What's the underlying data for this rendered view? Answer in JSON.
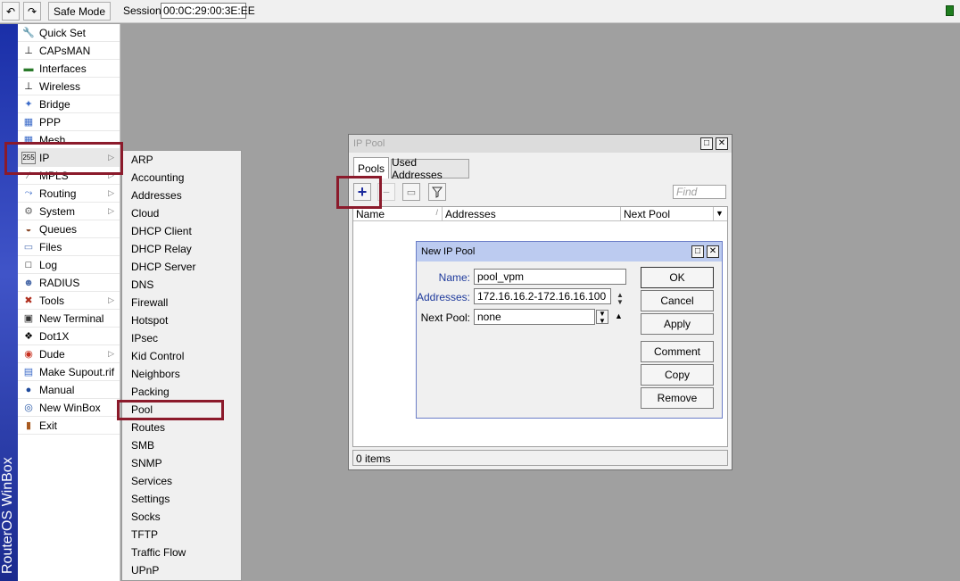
{
  "toolbar": {
    "undo_icon": "undo-icon",
    "redo_icon": "redo-icon",
    "safe_mode": "Safe Mode",
    "session_label": "Session:",
    "session_value": "00:0C:29:00:3E:EE"
  },
  "side_strip": {
    "brand": "RouterOS WinBox"
  },
  "main_menu": {
    "items": [
      {
        "label": "Quick Set",
        "icon": "quick-set-icon"
      },
      {
        "label": "CAPsMAN",
        "icon": "antenna-icon"
      },
      {
        "label": "Interfaces",
        "icon": "interfaces-icon"
      },
      {
        "label": "Wireless",
        "icon": "antenna-icon"
      },
      {
        "label": "Bridge",
        "icon": "bridge-icon"
      },
      {
        "label": "PPP",
        "icon": "ppp-icon"
      },
      {
        "label": "Mesh",
        "icon": "mesh-icon"
      },
      {
        "label": "IP",
        "icon": "ip-icon"
      },
      {
        "label": "MPLS",
        "icon": "mpls-icon"
      },
      {
        "label": "Routing",
        "icon": "routing-icon"
      },
      {
        "label": "System",
        "icon": "gear-icon"
      },
      {
        "label": "Queues",
        "icon": "queues-icon"
      },
      {
        "label": "Files",
        "icon": "folder-icon"
      },
      {
        "label": "Log",
        "icon": "log-icon"
      },
      {
        "label": "RADIUS",
        "icon": "radius-icon"
      },
      {
        "label": "Tools",
        "icon": "tools-icon"
      },
      {
        "label": "New Terminal",
        "icon": "terminal-icon"
      },
      {
        "label": "Dot1X",
        "icon": "dot1x-icon"
      },
      {
        "label": "Dude",
        "icon": "dude-icon"
      },
      {
        "label": "Make Supout.rif",
        "icon": "document-icon"
      },
      {
        "label": "Manual",
        "icon": "help-icon"
      },
      {
        "label": "New WinBox",
        "icon": "winbox-icon"
      },
      {
        "label": "Exit",
        "icon": "exit-icon"
      }
    ]
  },
  "ip_submenu": {
    "items": [
      "ARP",
      "Accounting",
      "Addresses",
      "Cloud",
      "DHCP Client",
      "DHCP Relay",
      "DHCP Server",
      "DNS",
      "Firewall",
      "Hotspot",
      "IPsec",
      "Kid Control",
      "Neighbors",
      "Packing",
      "Pool",
      "Routes",
      "SMB",
      "SNMP",
      "Services",
      "Settings",
      "Socks",
      "TFTP",
      "Traffic Flow",
      "UPnP"
    ]
  },
  "ip_pool_window": {
    "title": "IP Pool",
    "tabs": [
      "Pools",
      "Used Addresses"
    ],
    "find_placeholder": "Find",
    "columns": [
      "Name",
      "Addresses",
      "Next Pool"
    ],
    "status": "0 items"
  },
  "new_pool_dialog": {
    "title": "New IP Pool",
    "name_label": "Name:",
    "name_value": "pool_vpm",
    "addresses_label": "Addresses:",
    "addresses_value": "172.16.16.2-172.16.16.100",
    "next_pool_label": "Next Pool:",
    "next_pool_value": "none",
    "buttons": [
      "OK",
      "Cancel",
      "Apply",
      "Comment",
      "Copy",
      "Remove"
    ]
  },
  "colors": {
    "highlight": "#8b1a2b",
    "dialog_title": "#bccbf0",
    "desktop": "#a0a0a0"
  }
}
